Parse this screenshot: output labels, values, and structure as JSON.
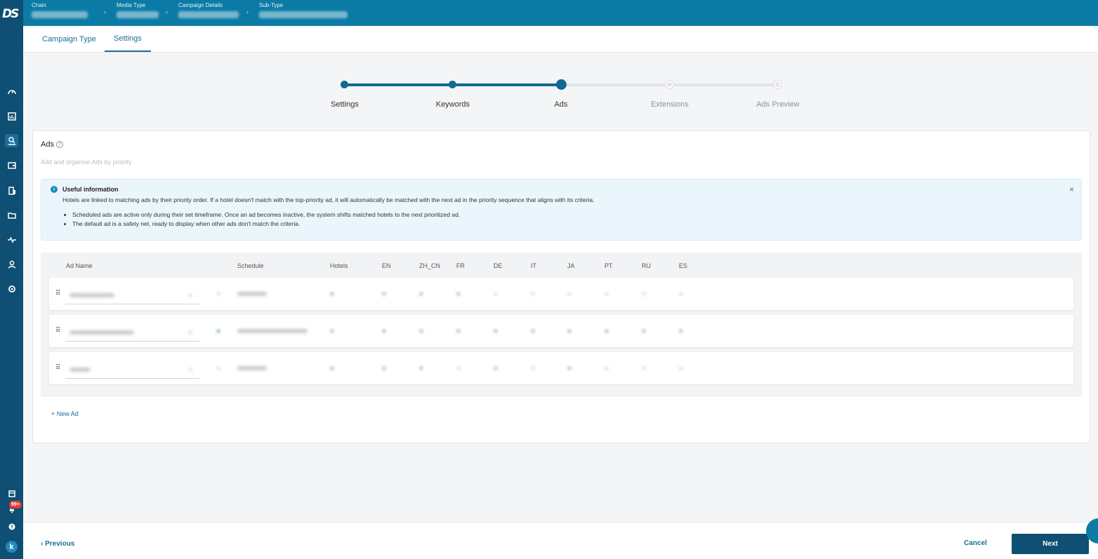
{
  "app": {
    "logo": "DS"
  },
  "breadcrumb": [
    {
      "label": "Chain"
    },
    {
      "label": "Media Type"
    },
    {
      "label": "Campaign Details"
    },
    {
      "label": "Sub-Type"
    }
  ],
  "tabs": [
    {
      "label": "Campaign Type",
      "active": false
    },
    {
      "label": "Settings",
      "active": true
    }
  ],
  "stepper": [
    {
      "label": "Settings",
      "state": "done"
    },
    {
      "label": "Keywords",
      "state": "done"
    },
    {
      "label": "Ads",
      "state": "current"
    },
    {
      "label": "Extensions",
      "state": "todo"
    },
    {
      "label": "Ads Preview",
      "state": "todo"
    }
  ],
  "ads_section": {
    "title": "Ads",
    "help_glyph": "?",
    "subtitle": "Add and organise Ads by priority"
  },
  "info": {
    "icon_glyph": "i",
    "title": "Useful information",
    "text": "Hotels are linked to matching ads by their priority order. If a hotel doesn't match with the top-priority ad, it will automatically be matched with the next ad in the priority sequence that aligns with its criteria.",
    "bullets": [
      "Scheduled ads are active only during their set timeframe. Once an ad becomes inactive, the system shifts matched hotels to the next prioritized ad.",
      "The default ad is a safety net, ready to display when other ads don't match the criteria."
    ],
    "close_glyph": "×"
  },
  "table": {
    "columns": [
      "Ad Name",
      "Schedule",
      "Hotels",
      "EN",
      "ZH_CN",
      "FR",
      "DE",
      "IT",
      "JA",
      "PT",
      "RU",
      "ES"
    ],
    "rows_count_note": "values blurred",
    "drag_glyph": "⠿"
  },
  "new_ad_label": "+ New Ad",
  "footer": {
    "previous_label": "Previous",
    "previous_glyph": "‹",
    "cancel_label": "Cancel",
    "next_label": "Next"
  },
  "sidebar": {
    "icons": [
      "dashboard-icon",
      "reports-icon",
      "campaigns-icon",
      "wallet-icon",
      "buildings-icon",
      "folder-icon",
      "activity-icon",
      "user-icon",
      "settings-icon",
      "calendar-icon",
      "notifications-icon",
      "help-icon"
    ],
    "notification_badge": "99+",
    "avatar_letter": "k"
  },
  "colors": {
    "sidebar": "#0e4f73",
    "topbar": "#0b7ba6",
    "accent": "#1a6e97",
    "step_done": "#0e6a92"
  }
}
